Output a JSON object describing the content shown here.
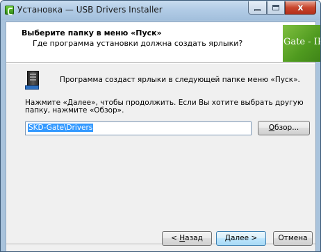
{
  "window": {
    "title": "Установка — USB Drivers Installer",
    "controls": {
      "minimize": "",
      "maximize": "",
      "close": "x"
    }
  },
  "header": {
    "title": "Выберите папку в меню «Пуск»",
    "subtitle": "Где программа установки должна создать ярлыки?",
    "logo_text": "Gate - IP"
  },
  "body": {
    "intro": "Программа создаст ярлыки в следующей папке меню «Пуск».",
    "instruction": "Нажмите «Далее», чтобы продолжить. Если Вы хотите выбрать другую папку, нажмите «Обзор».",
    "folder_value": "SKD-Gate\\Drivers",
    "browse_label": "Обзор...",
    "browse_hotkey": "О",
    "browse_rest": "бзор..."
  },
  "footer": {
    "back_prefix": "< ",
    "back_hotkey": "Н",
    "back_rest": "азад",
    "next_hotkey": "Д",
    "next_rest": "алее >",
    "cancel_label": "Отмена"
  },
  "colors": {
    "selection": "#3399ff",
    "logo_green": "#4f9a1f",
    "title_bar": "#b2cce6",
    "close_button": "#c8452c"
  },
  "icons": {
    "app": "installer-green-icon",
    "folder": "start-menu-folder-icon"
  }
}
